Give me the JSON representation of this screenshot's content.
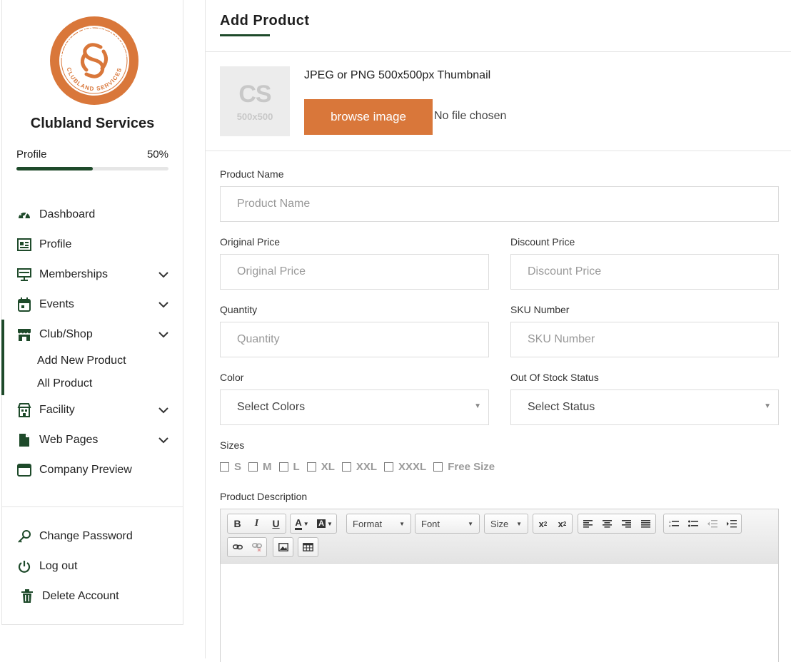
{
  "brand": {
    "name": "Clubland Services",
    "logo_text": "CLUBLAND SERVICES",
    "logo_initials": "CS",
    "accent": "#d9773a",
    "primary": "#1e4a2a"
  },
  "profile": {
    "label": "Profile",
    "percent_text": "50%",
    "progress": 0.5
  },
  "nav": {
    "dashboard": "Dashboard",
    "profile": "Profile",
    "memberships": "Memberships",
    "events": "Events",
    "club_shop": "Club/Shop",
    "add_new_product": "Add New Product",
    "all_product": "All Product",
    "facility": "Facility",
    "web_pages": "Web Pages",
    "company_preview": "Company Preview",
    "change_password": "Change Password",
    "log_out": "Log out",
    "delete_account": "Delete Account"
  },
  "page": {
    "title": "Add Product"
  },
  "thumbnail": {
    "placeholder_initials": "CS",
    "placeholder_size": "500x500",
    "hint": "JPEG or PNG 500x500px Thumbnail",
    "browse_label": "browse image",
    "file_status": "No file chosen"
  },
  "form": {
    "product_name": {
      "label": "Product Name",
      "placeholder": "Product Name"
    },
    "original_price": {
      "label": "Original Price",
      "placeholder": "Original Price"
    },
    "discount_price": {
      "label": "Discount Price",
      "placeholder": "Discount Price"
    },
    "quantity": {
      "label": "Quantity",
      "placeholder": "Quantity"
    },
    "sku": {
      "label": "SKU Number",
      "placeholder": "SKU Number"
    },
    "color": {
      "label": "Color",
      "value": "Select Colors"
    },
    "stock_status": {
      "label": "Out Of Stock Status",
      "value": "Select Status"
    },
    "sizes": {
      "label": "Sizes",
      "options": [
        "S",
        "M",
        "L",
        "XL",
        "XXL",
        "XXXL",
        "Free Size"
      ]
    },
    "description": {
      "label": "Product Description"
    }
  },
  "editor": {
    "format_label": "Format",
    "font_label": "Font",
    "size_label": "Size"
  }
}
